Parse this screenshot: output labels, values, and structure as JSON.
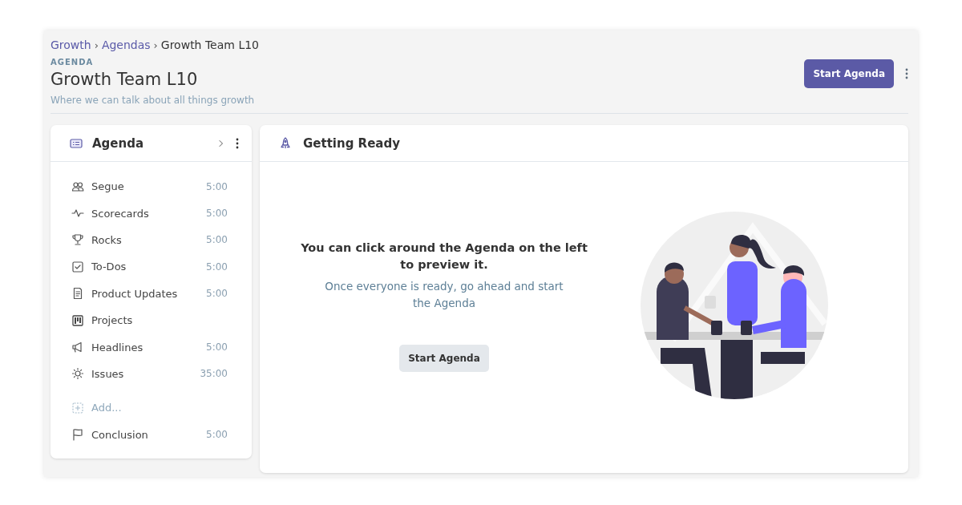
{
  "breadcrumb_separator": "›",
  "breadcrumb": [
    {
      "label": "Growth",
      "kind": "link"
    },
    {
      "label": "Agendas",
      "kind": "link"
    },
    {
      "label": "Growth Team L10",
      "kind": "current"
    }
  ],
  "header": {
    "eyebrow": "AGENDA",
    "title": "Growth Team L10",
    "description": "Where we can talk about all things growth",
    "primary_button": "Start Agenda"
  },
  "sidebar": {
    "title": "Agenda",
    "items": [
      {
        "kind": "item",
        "label": "Segue",
        "time": "5:00"
      },
      {
        "kind": "item",
        "label": "Scorecards",
        "time": "5:00"
      },
      {
        "kind": "item",
        "label": "Rocks",
        "time": "5:00"
      },
      {
        "kind": "item",
        "label": "To-Dos",
        "time": "5:00"
      },
      {
        "kind": "item",
        "label": "Product Updates",
        "time": "5:00"
      },
      {
        "kind": "item",
        "label": "Projects"
      },
      {
        "kind": "item",
        "label": "Headlines",
        "time": "5:00"
      },
      {
        "kind": "item",
        "label": "Issues",
        "time": "35:00"
      },
      {
        "kind": "add",
        "label": "Add..."
      },
      {
        "kind": "item",
        "label": "Conclusion",
        "time": "5:00"
      }
    ]
  },
  "panel": {
    "title": "Getting Ready",
    "heading": "You can click around the Agenda on the left to preview it.",
    "subtext": "Once everyone is ready, go ahead and start the Agenda",
    "button": "Start Agenda"
  }
}
